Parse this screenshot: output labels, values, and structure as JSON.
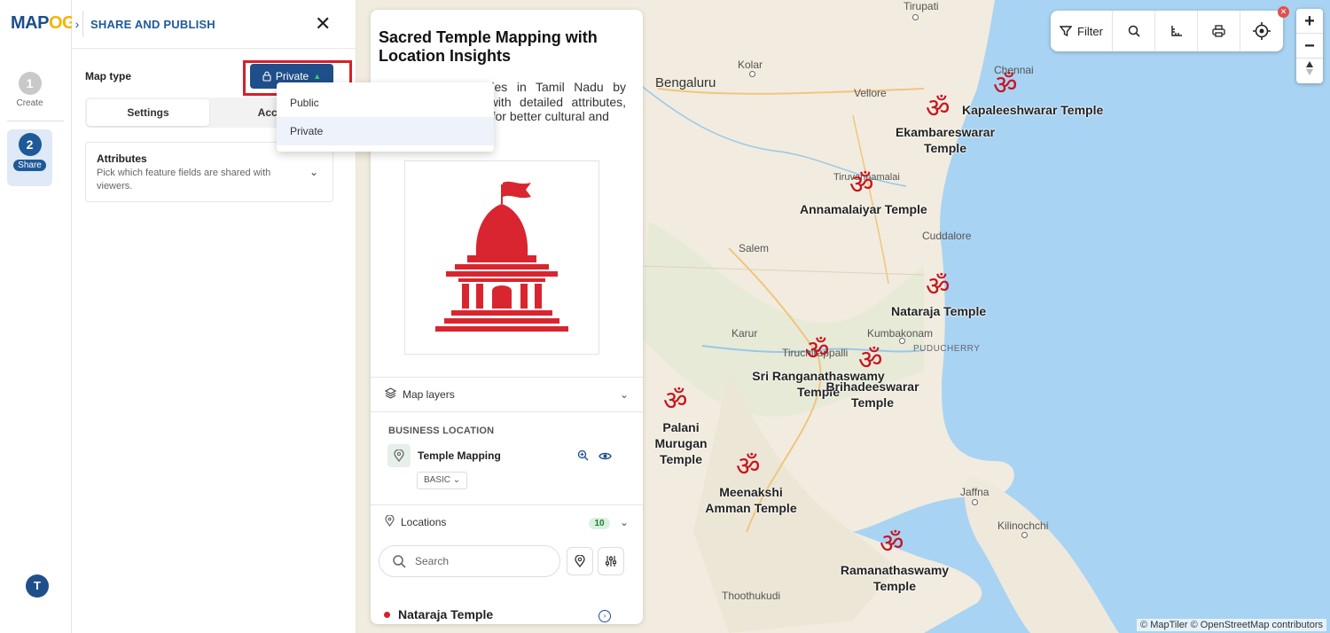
{
  "app": {
    "logo_part1": "MAP",
    "logo_part2": "OG"
  },
  "stepper": {
    "steps": [
      {
        "number": "1",
        "label": "Create",
        "state": "done"
      },
      {
        "number": "2",
        "label": "Share",
        "state": "active"
      }
    ],
    "avatar_initial": "T"
  },
  "share_panel": {
    "title": "SHARE AND PUBLISH",
    "map_type_label": "Map type",
    "privacy_button_label": "Private",
    "tabs": [
      {
        "label": "Settings",
        "active": true
      },
      {
        "label": "Acce",
        "active": false
      }
    ],
    "attributes": {
      "title": "Attributes",
      "description": "Pick which feature fields are shared with viewers."
    },
    "dropdown": {
      "options": [
        "Public",
        "Private"
      ],
      "selected": "Private"
    }
  },
  "map_card": {
    "title": "Sacred Temple Mapping with Location Insights",
    "description": "Visualize the temples in Tamil Nadu by location, enriched with detailed attributes, images and insights for better cultural and",
    "layers_section": {
      "label": "Map layers",
      "group_label": "BUSINESS LOCATION",
      "layer_name": "Temple Mapping",
      "style_label": "BASIC"
    },
    "locations_section": {
      "label": "Locations",
      "count": "10",
      "search_placeholder": "Search",
      "first_item": "Nataraja Temple"
    }
  },
  "map_toolbar": {
    "filter_label": "Filter",
    "zoom_in": "+",
    "zoom_out": "−"
  },
  "map": {
    "places": [
      "Tirupati",
      "Kolar",
      "Bengaluru",
      "Chennai",
      "Vellore",
      "Tiruvannamalai",
      "Salem",
      "Cuddalore",
      "Karur",
      "Kumbakonam",
      "PUDUCHERRY",
      "Tiruchirappalli",
      "Jaffna",
      "Kilinochchi",
      "Thoothukudi"
    ],
    "temples": [
      {
        "name": "Kapaleeshwarar Temple"
      },
      {
        "name": "Ekambareswarar Temple"
      },
      {
        "name": "Annamalaiyar Temple"
      },
      {
        "name": "Nataraja Temple"
      },
      {
        "name": "Sri Ranganathaswamy Temple"
      },
      {
        "name": "Brihadeeswarar Temple"
      },
      {
        "name": "Palani Murugan Temple"
      },
      {
        "name": "Meenakshi Amman Temple"
      },
      {
        "name": "Ramanathaswamy Temple"
      }
    ],
    "attribution": "© MapTiler © OpenStreetMap contributors"
  },
  "colors": {
    "brand_blue": "#1f4f8a",
    "highlight_red": "#d6202a",
    "sea": "#a9d3f2",
    "land": "#f1ecdf"
  }
}
